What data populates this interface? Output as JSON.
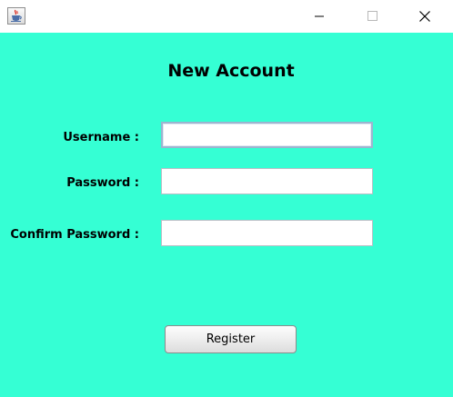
{
  "titlebar": {
    "app_icon": "java-coffee-cup-icon",
    "controls": {
      "minimize_icon": "minimize-icon",
      "maximize_icon": "maximize-icon",
      "close_icon": "close-icon"
    }
  },
  "form": {
    "title": "New Account",
    "username_label": "Username :",
    "password_label": "Password :",
    "confirm_label": "Confirm Password :",
    "username_value": "",
    "password_value": "",
    "confirm_value": "",
    "register_label": "Register"
  },
  "colors": {
    "background": "#35FFD4",
    "titlebar": "#FFFFFF",
    "field_focus_border": "#9CB4CF"
  }
}
